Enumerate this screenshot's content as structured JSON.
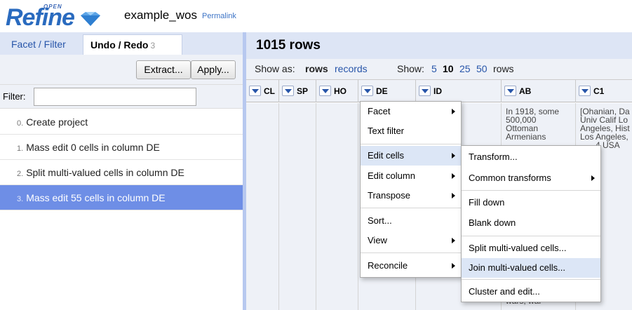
{
  "header": {
    "logo_open": "OPEN",
    "logo_word": "Refine",
    "project_name": "example_wos",
    "permalink": "Permalink"
  },
  "left_panel": {
    "tabs": {
      "facet": "Facet / Filter",
      "undo": "Undo / Redo",
      "undo_count": "3"
    },
    "extract_button": "Extract...",
    "apply_button": "Apply...",
    "filter_label": "Filter:",
    "filter_value": "",
    "history": [
      {
        "num": "0.",
        "label": "Create project"
      },
      {
        "num": "1.",
        "label": "Mass edit 0 cells in column DE"
      },
      {
        "num": "2.",
        "label": "Split multi-valued cells in column DE"
      },
      {
        "num": "3.",
        "label": "Mass edit 55 cells in column DE"
      }
    ]
  },
  "main": {
    "row_count": "1015 rows",
    "show_as_label": "Show as:",
    "rows_link": "rows",
    "records_link": "records",
    "show_label": "Show:",
    "page_sizes": [
      "5",
      "10",
      "25",
      "50"
    ],
    "rows_suffix": "rows",
    "columns": [
      "CL",
      "SP",
      "HO",
      "DE",
      "ID",
      "AB",
      "C1"
    ],
    "cell_ab": [
      "In 1918, some",
      "500,000",
      "Ottoman",
      "Armenians"
    ],
    "cell_ab_bottom": "wars, war",
    "cell_c1": [
      "[Ohanian, Da",
      "Univ Calif Lo",
      "Angeles, Hist",
      "Los Angeles,",
      "4 USA"
    ]
  },
  "column_menu": {
    "items": [
      "Facet",
      "Text filter",
      "Edit cells",
      "Edit column",
      "Transpose",
      "Sort...",
      "View",
      "Reconcile"
    ]
  },
  "edit_cells_submenu": {
    "items": [
      "Transform...",
      "Common transforms",
      "Fill down",
      "Blank down",
      "Split multi-valued cells...",
      "Join multi-valued cells...",
      "Cluster and edit..."
    ]
  }
}
